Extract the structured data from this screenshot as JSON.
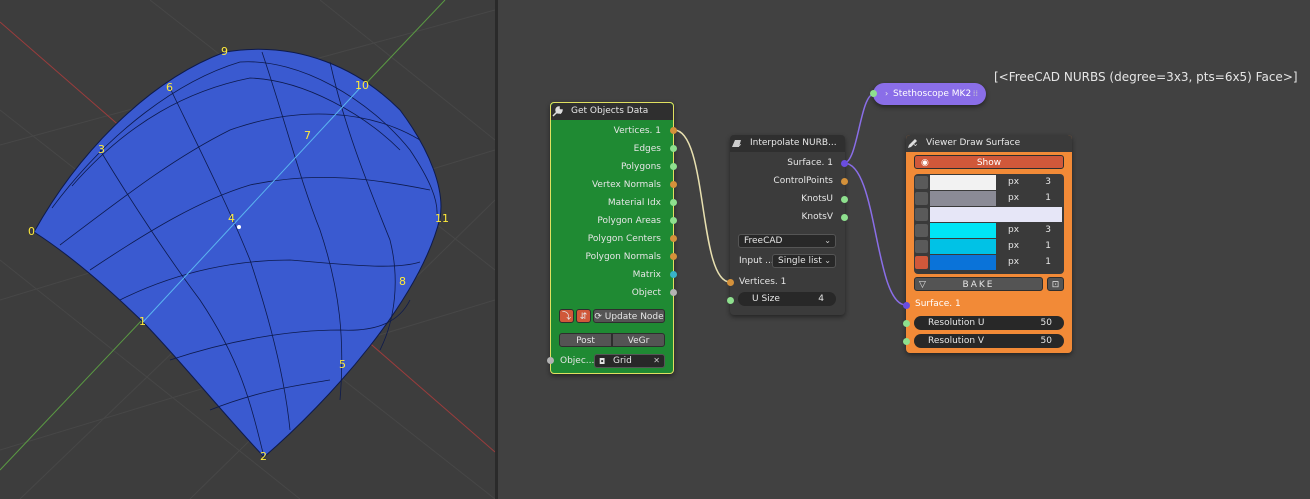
{
  "viewport": {
    "labels": [
      "0",
      "1",
      "2",
      "3",
      "4",
      "5",
      "6",
      "7",
      "8",
      "9",
      "10",
      "11"
    ]
  },
  "freecad_label": "[<FreeCAD NURBS (degree=3x3, pts=6x5) Face>]",
  "colors": {
    "get_objects_body": "#1f8a33",
    "viewer_body": "#f28a37",
    "socket_orange": "#d4913a",
    "socket_green": "#8ee08e",
    "socket_purple": "#6a4de0",
    "socket_teal": "#38b3c9",
    "socket_gray": "#b3b3b3"
  },
  "get_objects": {
    "title": "Get Objects Data",
    "outputs": [
      "Vertices. 1",
      "Edges",
      "Polygons",
      "Vertex Normals",
      "Material Idx",
      "Polygon Areas",
      "Polygon Centers",
      "Polygon Normals",
      "Matrix",
      "Object"
    ],
    "update_label": "Update Node",
    "post_label": "Post",
    "vegr_label": "VeGr",
    "object_label": "Objec...",
    "object_value": "Grid"
  },
  "interpolate": {
    "title": "Interpolate NURB...",
    "outputs": [
      "Surface. 1",
      "ControlPoints",
      "KnotsU",
      "KnotsV"
    ],
    "implementation": "FreeCAD",
    "input_label": "Input ...",
    "input_mode": "Single list",
    "vertices_label": "Vertices. 1",
    "usize_label": "U Size",
    "usize_value": "4"
  },
  "stethoscope": {
    "title": "Stethoscope MK2"
  },
  "viewer": {
    "title": "Viewer Draw Surface",
    "show_label": "Show",
    "rows": [
      {
        "color": "#f2f2f2",
        "unit": "px",
        "value": "3"
      },
      {
        "color": "#8b8b96",
        "unit": "px",
        "value": "1"
      },
      {
        "color": "#e6e6f7",
        "unit": "",
        "value": ""
      },
      {
        "color": "#00e5f5",
        "unit": "px",
        "value": "3"
      },
      {
        "color": "#00c2e6",
        "unit": "px",
        "value": "1"
      },
      {
        "color": "#0a73d9",
        "unit": "px",
        "value": "1"
      }
    ],
    "bake_label": "BAKE",
    "surface_label": "Surface. 1",
    "res_u_label": "Resolution U",
    "res_u_value": "50",
    "res_v_label": "Resolution V",
    "res_v_value": "50"
  }
}
